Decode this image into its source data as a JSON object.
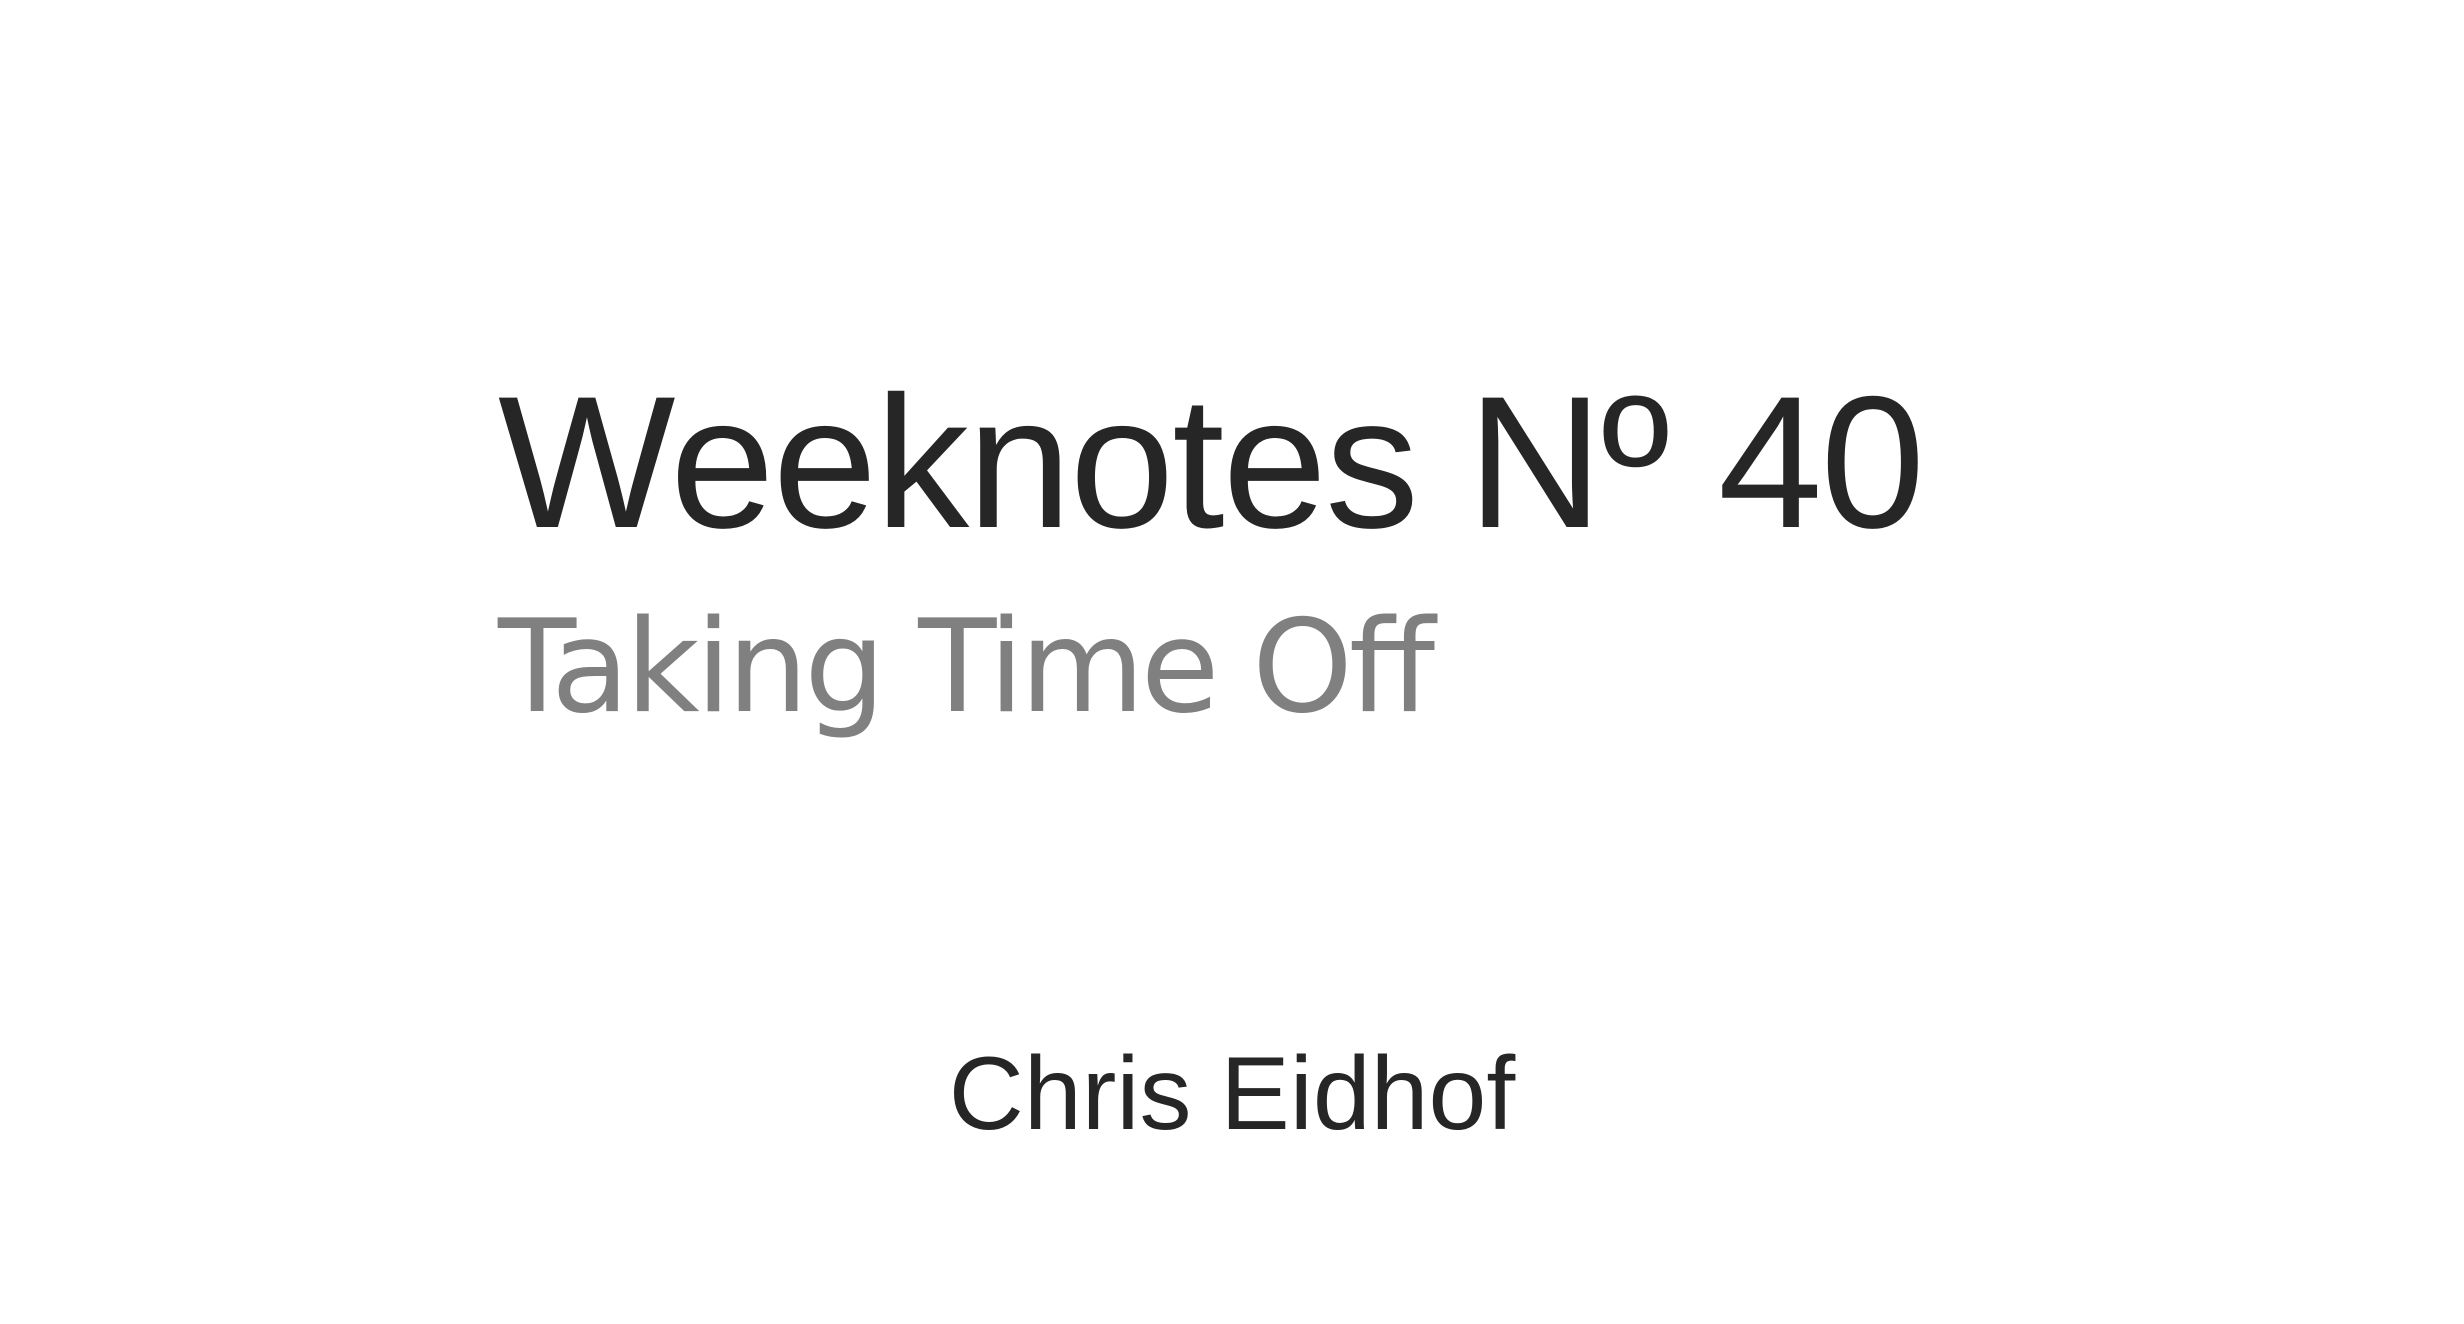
{
  "card": {
    "title": "Weeknotes Nº 40",
    "subtitle": "Taking Time Off",
    "author": "Chris Eidhof"
  },
  "colors": {
    "background": "#ffffff",
    "title": "#262626",
    "subtitle": "#808080",
    "author": "#262626"
  }
}
